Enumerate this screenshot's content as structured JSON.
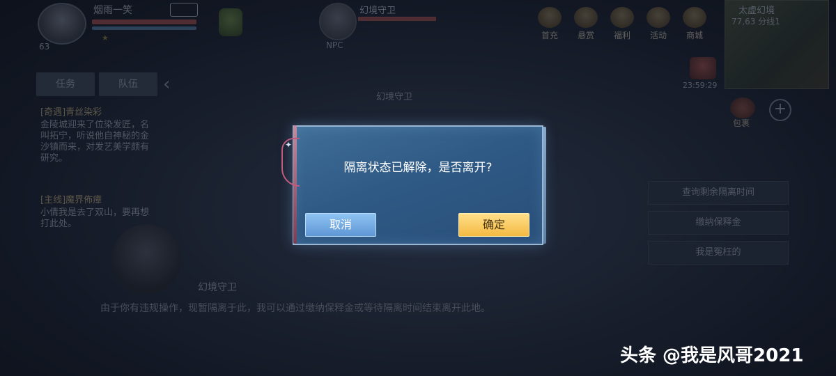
{
  "player": {
    "name": "烟雨一笑",
    "level": "63",
    "tag": "",
    "hp_fraction": 1.0,
    "mp_fraction": 1.0
  },
  "target": {
    "label": "NPC",
    "name": "幻境守卫",
    "hp_fraction": 1.0
  },
  "top_menu": [
    {
      "label": "首充",
      "icon": "gift-icon"
    },
    {
      "label": "悬赏",
      "icon": "bounty-icon"
    },
    {
      "label": "福利",
      "icon": "welfare-icon"
    },
    {
      "label": "活动",
      "icon": "event-icon"
    },
    {
      "label": "商城",
      "icon": "shop-icon"
    }
  ],
  "minimap": {
    "title": "太虚幻境",
    "coords": "77,63 分线1"
  },
  "gift_timer": "23:59:29",
  "bag_label": "包裹",
  "plus_label": "+",
  "quest_panel": {
    "tabs": [
      "任务",
      "队伍"
    ],
    "collapse_icon": "‹",
    "quests": [
      {
        "title": "[奇遇]青丝染彩",
        "desc": "金陵城迎来了位染发匠，名叫拓宁，听说他自神秘的金沙镇而来，对发艺美学颇有研究。"
      },
      {
        "title": "[主线]魔界佈瘴",
        "desc": "小倩我是去了双山，要再想打此处。"
      }
    ]
  },
  "scene_npc_label": "幻境守卫",
  "side_buttons": [
    "查询剩余隔离时间",
    "缴纳保释金",
    "我是冤枉的"
  ],
  "dialog": {
    "speaker": "幻境守卫",
    "text": "由于你有违规操作，现暂隔离于此，我可以通过缴纳保释金或等待隔离时间结束离开此地。"
  },
  "modal": {
    "message": "隔离状态已解除，是否离开?",
    "cancel_label": "取消",
    "confirm_label": "确定",
    "colors": {
      "cancel": "#7fb3ea",
      "confirm": "#f7c85a"
    }
  },
  "watermark": "头条 @我是风哥2021"
}
